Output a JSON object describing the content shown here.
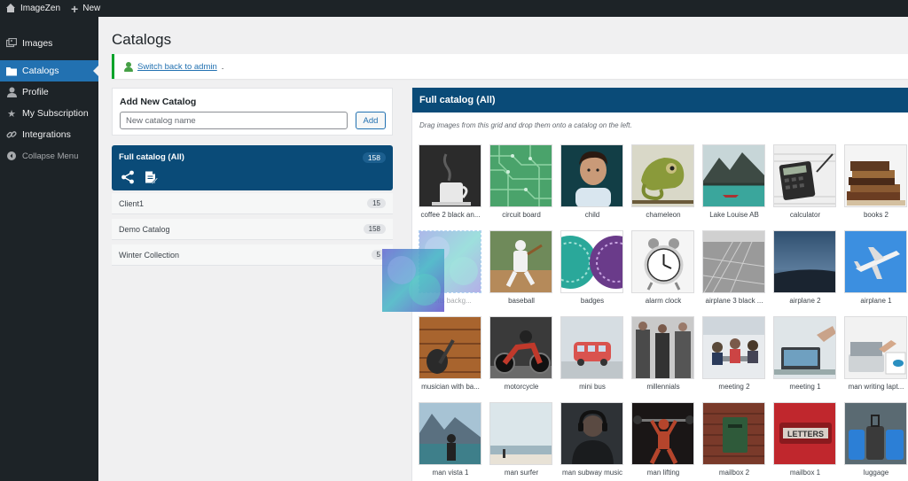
{
  "adminbar": {
    "site_name": "ImageZen",
    "new_label": "New"
  },
  "sidebar": {
    "items": [
      {
        "label": "Images"
      },
      {
        "label": "Catalogs"
      },
      {
        "label": "Profile"
      },
      {
        "label": "My Subscription"
      },
      {
        "label": "Integrations"
      },
      {
        "label": "Collapse Menu"
      }
    ]
  },
  "page": {
    "title": "Catalogs"
  },
  "notice": {
    "link_text": "Switch back to admin",
    "suffix": "."
  },
  "add_catalog": {
    "heading": "Add New Catalog",
    "placeholder": "New catalog name",
    "value": "",
    "button": "Add"
  },
  "catalogs": {
    "active": {
      "name": "Full catalog (All)",
      "count": "158"
    },
    "list": [
      {
        "name": "Client1",
        "count": "15"
      },
      {
        "name": "Demo Catalog",
        "count": "158"
      },
      {
        "name": "Winter Collection",
        "count": "5"
      }
    ]
  },
  "grid": {
    "title": "Full catalog (All)",
    "hint": "Drag images from this grid and drop them onto a catalog on the left.",
    "images": [
      {
        "caption": "coffee 2 black an..."
      },
      {
        "caption": "circuit board"
      },
      {
        "caption": "child"
      },
      {
        "caption": "chameleon"
      },
      {
        "caption": "Lake Louise AB"
      },
      {
        "caption": "calculator"
      },
      {
        "caption": "books 2"
      },
      {
        "caption": "...nts backg..."
      },
      {
        "caption": "baseball"
      },
      {
        "caption": "badges"
      },
      {
        "caption": "alarm clock"
      },
      {
        "caption": "airplane 3 black ..."
      },
      {
        "caption": "airplane 2"
      },
      {
        "caption": "airplane 1"
      },
      {
        "caption": "musician with ba..."
      },
      {
        "caption": "motorcycle"
      },
      {
        "caption": "mini bus"
      },
      {
        "caption": "millennials"
      },
      {
        "caption": "meeting 2"
      },
      {
        "caption": "meeting 1"
      },
      {
        "caption": "man writing lapt..."
      },
      {
        "caption": "man vista 1"
      },
      {
        "caption": "man surfer"
      },
      {
        "caption": "man subway music"
      },
      {
        "caption": "man lifting"
      },
      {
        "caption": "mailbox 2"
      },
      {
        "caption": "mailbox 1"
      },
      {
        "caption": "luggage"
      }
    ]
  },
  "colors": {
    "accent": "#2271b1",
    "active_panel": "#0a4b78",
    "sidebar": "#1d2327",
    "success": "#00a32a"
  }
}
